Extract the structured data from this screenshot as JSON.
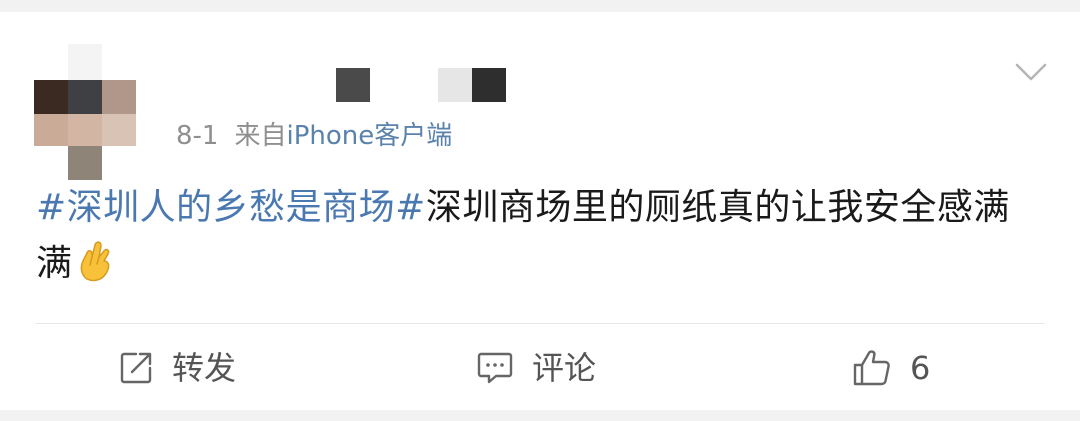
{
  "post": {
    "date": "8-1",
    "source_prefix": "来自",
    "source": "iPhone客户端",
    "topic": "#深圳人的乡愁是商场#",
    "text": "深圳商场里的厕纸真的让我安全感满满",
    "emoji_icon": "crossed-fingers-icon"
  },
  "actions": {
    "repost_label": "转发",
    "comment_label": "评论",
    "like_count": "6"
  },
  "colors": {
    "topic": "#4a78b0",
    "source": "#5a82ab",
    "meta": "#8f8f8f",
    "text": "#1a1a1a",
    "action": "#555555"
  }
}
